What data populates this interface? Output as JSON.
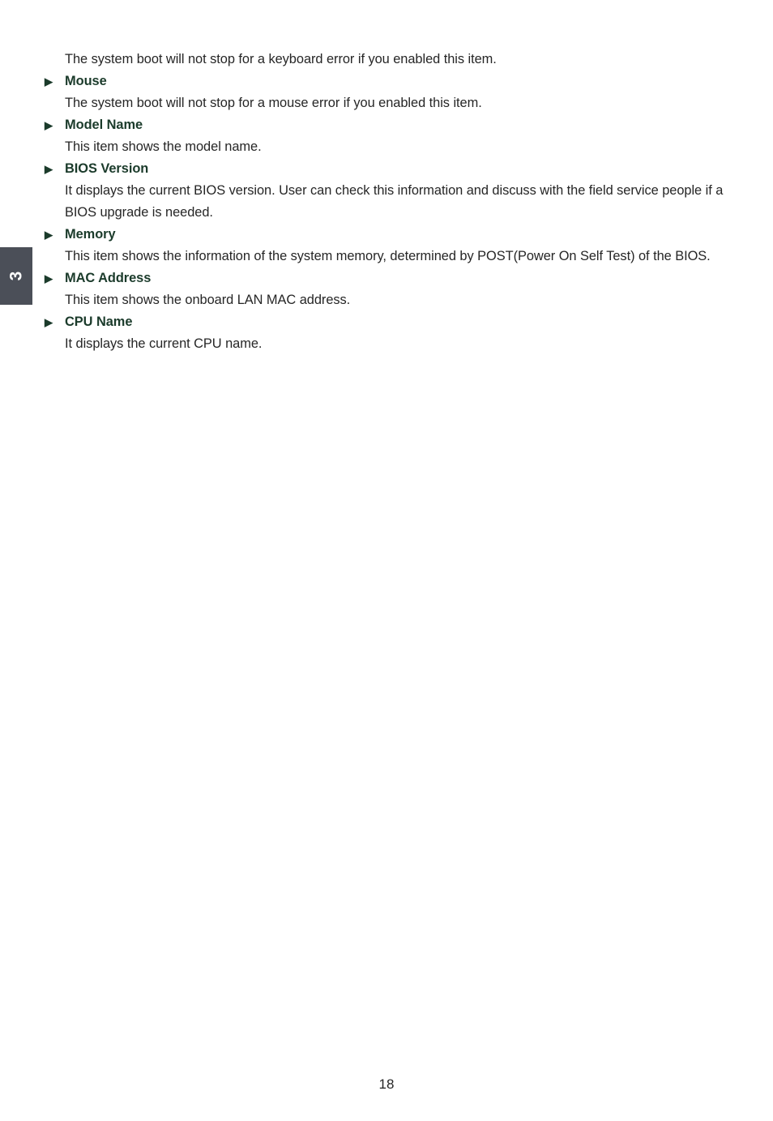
{
  "document": {
    "page_number": "18",
    "chapter_tab": {
      "label": "3",
      "background_color": "#4b4f58",
      "text_color": "#ffffff"
    },
    "colors": {
      "heading": "#1b3b2b",
      "body": "#262626",
      "page_background": "#ffffff"
    }
  },
  "content": {
    "blocks": [
      {
        "type": "paragraph",
        "text": "The system boot will not stop for a keyboard error if you enabled this item."
      },
      {
        "type": "heading",
        "bullet": "triangle-right-icon",
        "text": "Mouse"
      },
      {
        "type": "paragraph",
        "text": "The system boot will not stop for a mouse error if you enabled this item."
      },
      {
        "type": "heading",
        "bullet": "triangle-right-icon",
        "text": "Model Name"
      },
      {
        "type": "paragraph",
        "text": "This item shows the model name."
      },
      {
        "type": "heading",
        "bullet": "triangle-right-icon",
        "text": "BIOS Version"
      },
      {
        "type": "paragraph",
        "text": "It displays the current BIOS version. User can check this information and discuss with the field service people if a BIOS upgrade is needed."
      },
      {
        "type": "heading",
        "bullet": "triangle-right-icon",
        "text": "Memory"
      },
      {
        "type": "paragraph",
        "text": "This item shows the information of the system memory, determined by POST(Power On Self Test) of the BIOS."
      },
      {
        "type": "heading",
        "bullet": "triangle-right-icon",
        "text": "MAC Address"
      },
      {
        "type": "paragraph",
        "text": "This item shows the onboard LAN MAC address."
      },
      {
        "type": "heading",
        "bullet": "triangle-right-icon",
        "text": "CPU Name"
      },
      {
        "type": "paragraph",
        "text": "It displays the current CPU name."
      }
    ]
  }
}
